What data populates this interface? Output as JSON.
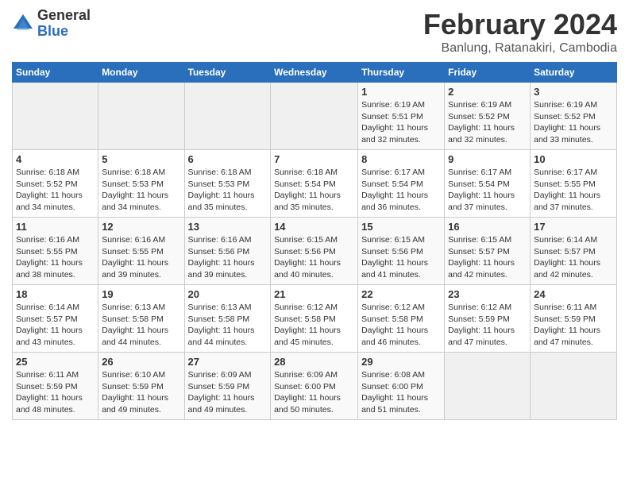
{
  "logo": {
    "general": "General",
    "blue": "Blue"
  },
  "title": "February 2024",
  "location": "Banlung, Ratanakiri, Cambodia",
  "days_of_week": [
    "Sunday",
    "Monday",
    "Tuesday",
    "Wednesday",
    "Thursday",
    "Friday",
    "Saturday"
  ],
  "weeks": [
    [
      {
        "day": "",
        "info": ""
      },
      {
        "day": "",
        "info": ""
      },
      {
        "day": "",
        "info": ""
      },
      {
        "day": "",
        "info": ""
      },
      {
        "day": "1",
        "info": "Sunrise: 6:19 AM\nSunset: 5:51 PM\nDaylight: 11 hours\nand 32 minutes."
      },
      {
        "day": "2",
        "info": "Sunrise: 6:19 AM\nSunset: 5:52 PM\nDaylight: 11 hours\nand 32 minutes."
      },
      {
        "day": "3",
        "info": "Sunrise: 6:19 AM\nSunset: 5:52 PM\nDaylight: 11 hours\nand 33 minutes."
      }
    ],
    [
      {
        "day": "4",
        "info": "Sunrise: 6:18 AM\nSunset: 5:52 PM\nDaylight: 11 hours\nand 34 minutes."
      },
      {
        "day": "5",
        "info": "Sunrise: 6:18 AM\nSunset: 5:53 PM\nDaylight: 11 hours\nand 34 minutes."
      },
      {
        "day": "6",
        "info": "Sunrise: 6:18 AM\nSunset: 5:53 PM\nDaylight: 11 hours\nand 35 minutes."
      },
      {
        "day": "7",
        "info": "Sunrise: 6:18 AM\nSunset: 5:54 PM\nDaylight: 11 hours\nand 35 minutes."
      },
      {
        "day": "8",
        "info": "Sunrise: 6:17 AM\nSunset: 5:54 PM\nDaylight: 11 hours\nand 36 minutes."
      },
      {
        "day": "9",
        "info": "Sunrise: 6:17 AM\nSunset: 5:54 PM\nDaylight: 11 hours\nand 37 minutes."
      },
      {
        "day": "10",
        "info": "Sunrise: 6:17 AM\nSunset: 5:55 PM\nDaylight: 11 hours\nand 37 minutes."
      }
    ],
    [
      {
        "day": "11",
        "info": "Sunrise: 6:16 AM\nSunset: 5:55 PM\nDaylight: 11 hours\nand 38 minutes."
      },
      {
        "day": "12",
        "info": "Sunrise: 6:16 AM\nSunset: 5:55 PM\nDaylight: 11 hours\nand 39 minutes."
      },
      {
        "day": "13",
        "info": "Sunrise: 6:16 AM\nSunset: 5:56 PM\nDaylight: 11 hours\nand 39 minutes."
      },
      {
        "day": "14",
        "info": "Sunrise: 6:15 AM\nSunset: 5:56 PM\nDaylight: 11 hours\nand 40 minutes."
      },
      {
        "day": "15",
        "info": "Sunrise: 6:15 AM\nSunset: 5:56 PM\nDaylight: 11 hours\nand 41 minutes."
      },
      {
        "day": "16",
        "info": "Sunrise: 6:15 AM\nSunset: 5:57 PM\nDaylight: 11 hours\nand 42 minutes."
      },
      {
        "day": "17",
        "info": "Sunrise: 6:14 AM\nSunset: 5:57 PM\nDaylight: 11 hours\nand 42 minutes."
      }
    ],
    [
      {
        "day": "18",
        "info": "Sunrise: 6:14 AM\nSunset: 5:57 PM\nDaylight: 11 hours\nand 43 minutes."
      },
      {
        "day": "19",
        "info": "Sunrise: 6:13 AM\nSunset: 5:58 PM\nDaylight: 11 hours\nand 44 minutes."
      },
      {
        "day": "20",
        "info": "Sunrise: 6:13 AM\nSunset: 5:58 PM\nDaylight: 11 hours\nand 44 minutes."
      },
      {
        "day": "21",
        "info": "Sunrise: 6:12 AM\nSunset: 5:58 PM\nDaylight: 11 hours\nand 45 minutes."
      },
      {
        "day": "22",
        "info": "Sunrise: 6:12 AM\nSunset: 5:58 PM\nDaylight: 11 hours\nand 46 minutes."
      },
      {
        "day": "23",
        "info": "Sunrise: 6:12 AM\nSunset: 5:59 PM\nDaylight: 11 hours\nand 47 minutes."
      },
      {
        "day": "24",
        "info": "Sunrise: 6:11 AM\nSunset: 5:59 PM\nDaylight: 11 hours\nand 47 minutes."
      }
    ],
    [
      {
        "day": "25",
        "info": "Sunrise: 6:11 AM\nSunset: 5:59 PM\nDaylight: 11 hours\nand 48 minutes."
      },
      {
        "day": "26",
        "info": "Sunrise: 6:10 AM\nSunset: 5:59 PM\nDaylight: 11 hours\nand 49 minutes."
      },
      {
        "day": "27",
        "info": "Sunrise: 6:09 AM\nSunset: 5:59 PM\nDaylight: 11 hours\nand 49 minutes."
      },
      {
        "day": "28",
        "info": "Sunrise: 6:09 AM\nSunset: 6:00 PM\nDaylight: 11 hours\nand 50 minutes."
      },
      {
        "day": "29",
        "info": "Sunrise: 6:08 AM\nSunset: 6:00 PM\nDaylight: 11 hours\nand 51 minutes."
      },
      {
        "day": "",
        "info": ""
      },
      {
        "day": "",
        "info": ""
      }
    ]
  ]
}
